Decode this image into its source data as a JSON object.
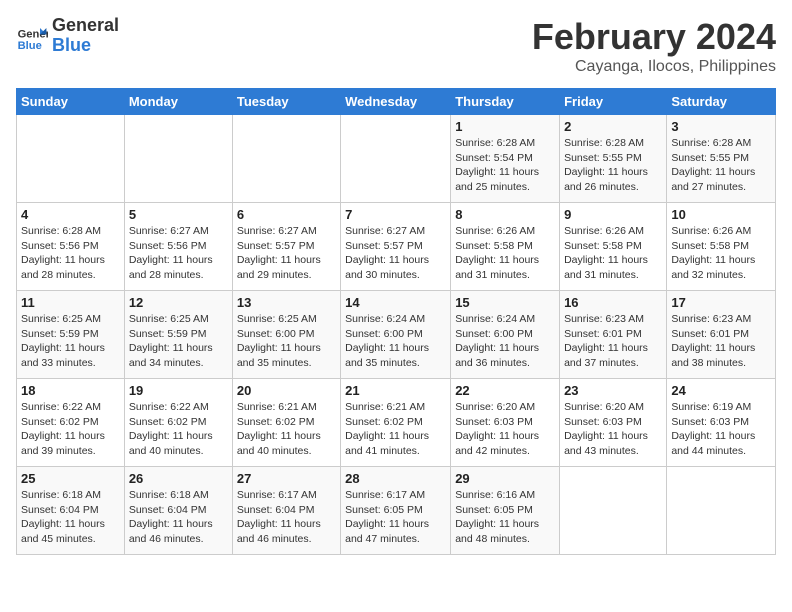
{
  "logo": {
    "line1": "General",
    "line2": "Blue"
  },
  "title": "February 2024",
  "subtitle": "Cayanga, Ilocos, Philippines",
  "days_of_week": [
    "Sunday",
    "Monday",
    "Tuesday",
    "Wednesday",
    "Thursday",
    "Friday",
    "Saturday"
  ],
  "weeks": [
    [
      {
        "day": "",
        "detail": ""
      },
      {
        "day": "",
        "detail": ""
      },
      {
        "day": "",
        "detail": ""
      },
      {
        "day": "",
        "detail": ""
      },
      {
        "day": "1",
        "detail": "Sunrise: 6:28 AM\nSunset: 5:54 PM\nDaylight: 11 hours\nand 25 minutes."
      },
      {
        "day": "2",
        "detail": "Sunrise: 6:28 AM\nSunset: 5:55 PM\nDaylight: 11 hours\nand 26 minutes."
      },
      {
        "day": "3",
        "detail": "Sunrise: 6:28 AM\nSunset: 5:55 PM\nDaylight: 11 hours\nand 27 minutes."
      }
    ],
    [
      {
        "day": "4",
        "detail": "Sunrise: 6:28 AM\nSunset: 5:56 PM\nDaylight: 11 hours\nand 28 minutes."
      },
      {
        "day": "5",
        "detail": "Sunrise: 6:27 AM\nSunset: 5:56 PM\nDaylight: 11 hours\nand 28 minutes."
      },
      {
        "day": "6",
        "detail": "Sunrise: 6:27 AM\nSunset: 5:57 PM\nDaylight: 11 hours\nand 29 minutes."
      },
      {
        "day": "7",
        "detail": "Sunrise: 6:27 AM\nSunset: 5:57 PM\nDaylight: 11 hours\nand 30 minutes."
      },
      {
        "day": "8",
        "detail": "Sunrise: 6:26 AM\nSunset: 5:58 PM\nDaylight: 11 hours\nand 31 minutes."
      },
      {
        "day": "9",
        "detail": "Sunrise: 6:26 AM\nSunset: 5:58 PM\nDaylight: 11 hours\nand 31 minutes."
      },
      {
        "day": "10",
        "detail": "Sunrise: 6:26 AM\nSunset: 5:58 PM\nDaylight: 11 hours\nand 32 minutes."
      }
    ],
    [
      {
        "day": "11",
        "detail": "Sunrise: 6:25 AM\nSunset: 5:59 PM\nDaylight: 11 hours\nand 33 minutes."
      },
      {
        "day": "12",
        "detail": "Sunrise: 6:25 AM\nSunset: 5:59 PM\nDaylight: 11 hours\nand 34 minutes."
      },
      {
        "day": "13",
        "detail": "Sunrise: 6:25 AM\nSunset: 6:00 PM\nDaylight: 11 hours\nand 35 minutes."
      },
      {
        "day": "14",
        "detail": "Sunrise: 6:24 AM\nSunset: 6:00 PM\nDaylight: 11 hours\nand 35 minutes."
      },
      {
        "day": "15",
        "detail": "Sunrise: 6:24 AM\nSunset: 6:00 PM\nDaylight: 11 hours\nand 36 minutes."
      },
      {
        "day": "16",
        "detail": "Sunrise: 6:23 AM\nSunset: 6:01 PM\nDaylight: 11 hours\nand 37 minutes."
      },
      {
        "day": "17",
        "detail": "Sunrise: 6:23 AM\nSunset: 6:01 PM\nDaylight: 11 hours\nand 38 minutes."
      }
    ],
    [
      {
        "day": "18",
        "detail": "Sunrise: 6:22 AM\nSunset: 6:02 PM\nDaylight: 11 hours\nand 39 minutes."
      },
      {
        "day": "19",
        "detail": "Sunrise: 6:22 AM\nSunset: 6:02 PM\nDaylight: 11 hours\nand 40 minutes."
      },
      {
        "day": "20",
        "detail": "Sunrise: 6:21 AM\nSunset: 6:02 PM\nDaylight: 11 hours\nand 40 minutes."
      },
      {
        "day": "21",
        "detail": "Sunrise: 6:21 AM\nSunset: 6:02 PM\nDaylight: 11 hours\nand 41 minutes."
      },
      {
        "day": "22",
        "detail": "Sunrise: 6:20 AM\nSunset: 6:03 PM\nDaylight: 11 hours\nand 42 minutes."
      },
      {
        "day": "23",
        "detail": "Sunrise: 6:20 AM\nSunset: 6:03 PM\nDaylight: 11 hours\nand 43 minutes."
      },
      {
        "day": "24",
        "detail": "Sunrise: 6:19 AM\nSunset: 6:03 PM\nDaylight: 11 hours\nand 44 minutes."
      }
    ],
    [
      {
        "day": "25",
        "detail": "Sunrise: 6:18 AM\nSunset: 6:04 PM\nDaylight: 11 hours\nand 45 minutes."
      },
      {
        "day": "26",
        "detail": "Sunrise: 6:18 AM\nSunset: 6:04 PM\nDaylight: 11 hours\nand 46 minutes."
      },
      {
        "day": "27",
        "detail": "Sunrise: 6:17 AM\nSunset: 6:04 PM\nDaylight: 11 hours\nand 46 minutes."
      },
      {
        "day": "28",
        "detail": "Sunrise: 6:17 AM\nSunset: 6:05 PM\nDaylight: 11 hours\nand 47 minutes."
      },
      {
        "day": "29",
        "detail": "Sunrise: 6:16 AM\nSunset: 6:05 PM\nDaylight: 11 hours\nand 48 minutes."
      },
      {
        "day": "",
        "detail": ""
      },
      {
        "day": "",
        "detail": ""
      }
    ]
  ]
}
